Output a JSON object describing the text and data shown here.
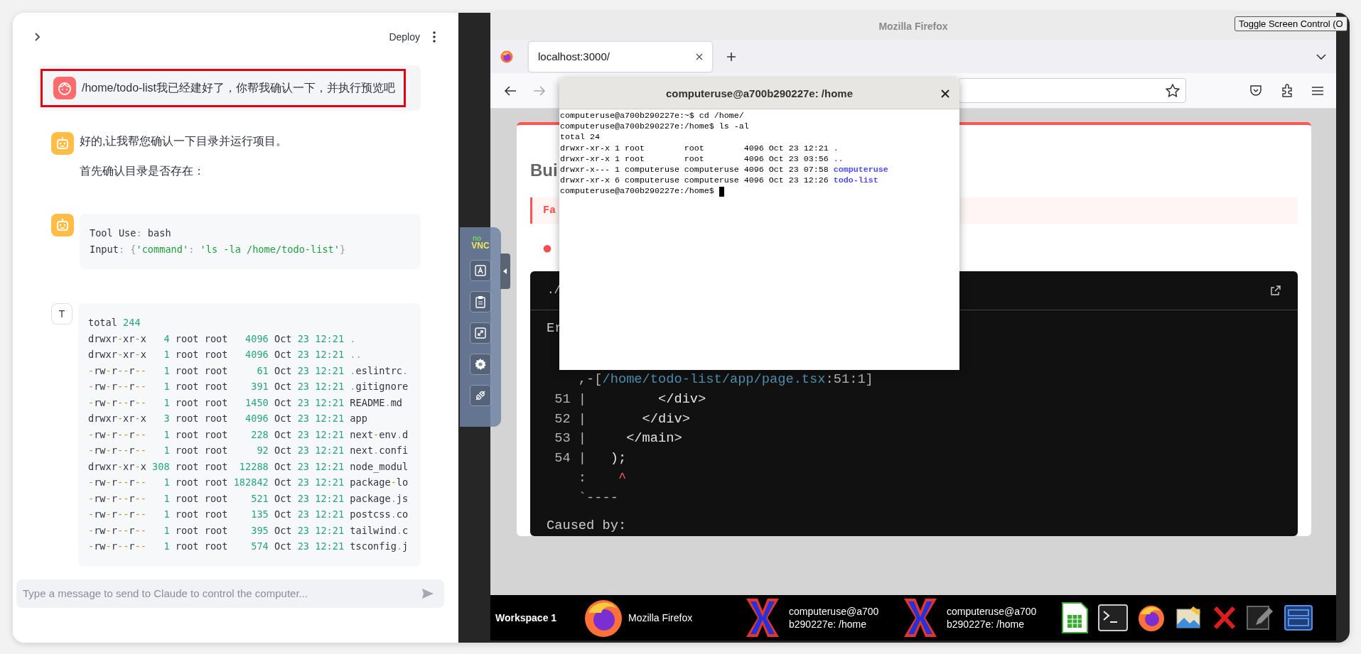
{
  "header": {
    "deploy_label": "Deploy"
  },
  "messages": [
    {
      "kind": "user",
      "highlighted": true,
      "paragraphs": [
        "/home/todo-list我已经建好了，你帮我确认一下，并执行预览吧"
      ]
    },
    {
      "kind": "assistant",
      "paragraphs": [
        "好的,让我帮您确认一下目录并运行项目。",
        "首先确认目录是否存在："
      ]
    },
    {
      "kind": "tool",
      "lines": [
        "Tool Use: bash",
        "Input: {'command': 'ls -la /home/todo-list'}"
      ]
    },
    {
      "kind": "result",
      "avatar": "T",
      "lines": [
        "total 244",
        "drwxr-xr-x   4 root root   4096 Oct 23 12:21 .",
        "drwxr-xr-x   1 root root   4096 Oct 23 12:21 ..",
        "-rw-r--r--   1 root root     61 Oct 23 12:21 .eslintrc.",
        "-rw-r--r--   1 root root    391 Oct 23 12:21 .gitignore",
        "-rw-r--r--   1 root root   1450 Oct 23 12:21 README.md",
        "drwxr-xr-x   3 root root   4096 Oct 23 12:21 app",
        "-rw-r--r--   1 root root    228 Oct 23 12:21 next-env.d",
        "-rw-r--r--   1 root root     92 Oct 23 12:21 next.confi",
        "drwxr-xr-x 308 root root  12288 Oct 23 12:21 node_modul",
        "-rw-r--r--   1 root root 182842 Oct 23 12:21 package-lo",
        "-rw-r--r--   1 root root    521 Oct 23 12:21 package.js",
        "-rw-r--r--   1 root root    135 Oct 23 12:21 postcss.co",
        "-rw-r--r--   1 root root    395 Oct 23 12:21 tailwind.c",
        "-rw-r--r--   1 root root    574 Oct 23 12:21 tsconfig.j"
      ]
    }
  ],
  "chat_input": {
    "placeholder": "Type a message to send to Claude to control the computer..."
  },
  "vnc_panel": {
    "logo": [
      "no",
      "VNC"
    ]
  },
  "toggle_button": "Toggle Screen Control (O",
  "firefox": {
    "title": "Mozilla Firefox",
    "tabs": [
      {
        "label": "localhost:3000/",
        "selected": true
      }
    ],
    "page": {
      "heading": "Bui",
      "alert": "Fa",
      "code_header": "./",
      "message": "Er",
      "source_lines": [
        {
          "gutter": "    ,-[",
          "path": "/home/todo-list/app/page.tsx",
          "tail": ":51:1]"
        },
        {
          "gutter": " 51 | ",
          "code": "        </div>"
        },
        {
          "gutter": " 52 | ",
          "code": "      </div>"
        },
        {
          "gutter": " 53 | ",
          "code": "    </main>"
        },
        {
          "gutter": " 54 | ",
          "code": "  );"
        },
        {
          "gutter": "    :    ",
          "marker": "^"
        },
        {
          "gutter": "    `----"
        }
      ],
      "cause": "Caused by:"
    }
  },
  "terminal": {
    "title": "computeruse@a700b290227e: /home",
    "lines": [
      {
        "text": "computeruse@a700b290227e:~$ cd /home/"
      },
      {
        "text": "computeruse@a700b290227e:/home$ ls -al"
      },
      {
        "text": "total 24"
      },
      {
        "text": "drwxr-xr-x 1 root        root        4096 Oct 23 12:21 ",
        "dir": "."
      },
      {
        "text": "drwxr-xr-x 1 root        root        4096 Oct 23 03:56 ",
        "dir": ".."
      },
      {
        "text": "drwxr-x--- 1 computeruse computeruse 4096 Oct 23 07:58 ",
        "dir": "computeruse"
      },
      {
        "text": "drwxr-xr-x 6 computeruse computeruse 4096 Oct 23 12:26 ",
        "dir": "todo-list"
      },
      {
        "text": "computeruse@a700b290227e:/home$ ",
        "cursor": true
      }
    ]
  },
  "taskbar": {
    "workspace": "Workspace 1",
    "tasks": [
      {
        "kind": "firefox",
        "label": [
          "Mozilla Firefox"
        ]
      },
      {
        "kind": "xterm",
        "label": [
          "computeruse@a700",
          "b290227e: /home"
        ]
      },
      {
        "kind": "xterm",
        "label": [
          "computeruse@a700",
          "b290227e: /home"
        ]
      }
    ]
  }
}
